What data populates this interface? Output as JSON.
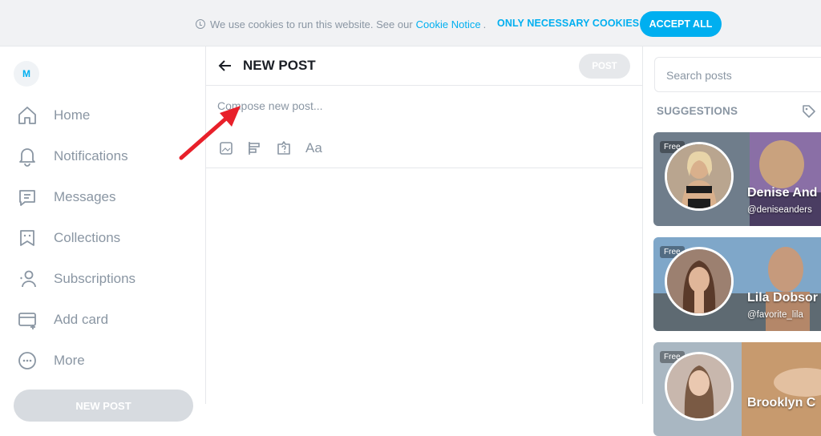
{
  "cookie_bar": {
    "text": "We use cookies to run this website. See our",
    "link": "Cookie Notice",
    "trailing": ".",
    "only_necessary_label": "ONLY NECESSARY COOKIES",
    "accept_all_label": "ACCEPT ALL"
  },
  "sidebar": {
    "avatar_initial": "M",
    "items": [
      {
        "label": "Home",
        "icon": "home-icon"
      },
      {
        "label": "Notifications",
        "icon": "bell-icon"
      },
      {
        "label": "Messages",
        "icon": "message-icon"
      },
      {
        "label": "Collections",
        "icon": "bookmark-icon"
      },
      {
        "label": "Subscriptions",
        "icon": "subscriptions-icon"
      },
      {
        "label": "Add card",
        "icon": "card-icon"
      },
      {
        "label": "More",
        "icon": "more-icon"
      }
    ],
    "new_post_label": "NEW POST"
  },
  "main": {
    "title": "NEW POST",
    "post_button_label": "POST",
    "compose_placeholder": "Compose new post...",
    "toolbar_icons": [
      "image-icon",
      "poll-icon",
      "quiz-icon",
      "text-format-icon"
    ],
    "text_format_label": "Aa",
    "annotation_color": "#e8202a"
  },
  "right_panel": {
    "search_placeholder": "Search posts",
    "suggestions_title": "SUGGESTIONS",
    "cards": [
      {
        "badge": "Free",
        "name": "Denise And",
        "handle": "@deniseanders"
      },
      {
        "badge": "Free",
        "name": "Lila Dobsor",
        "handle": "@favorite_lila"
      },
      {
        "badge": "Free",
        "name": "Brooklyn C",
        "handle": ""
      }
    ]
  },
  "colors": {
    "accent": "#00aff0",
    "muted_text": "#8a96a3",
    "divider": "#e6e8eb"
  }
}
